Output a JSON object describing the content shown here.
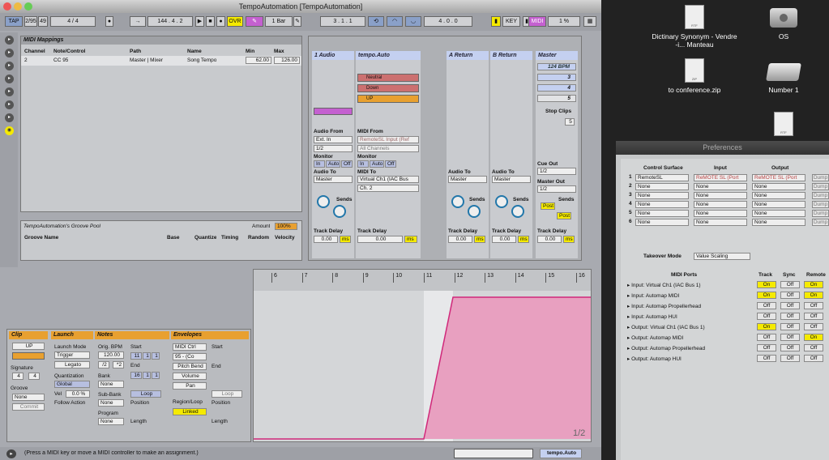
{
  "window_title": "TempoAutomation  [TempoAutomation]",
  "transport": {
    "tap": "TAP",
    "sig": "2/95",
    "sig2": "49",
    "meter": "4  /  4",
    "tempo": "144 . 4 . 2",
    "quant": "1 Bar",
    "pos": "3 . 1 . 1",
    "pos2": "4 . 0 . 0",
    "key": "KEY",
    "midi": "MIDI",
    "cpu": "1 %",
    "ovr": "OVR"
  },
  "desktop": {
    "icons": [
      {
        "label": "Dictinary Synonym - Vendre -i... Manteau",
        "kind": "RTF"
      },
      {
        "label": "OS",
        "kind": "disk"
      },
      {
        "label": "to conference.zip",
        "kind": "ZIP"
      },
      {
        "label": "Number 1",
        "kind": "hdd"
      },
      {
        "label": "",
        "kind": "RTF"
      }
    ]
  },
  "prefs": {
    "title": "Preferences",
    "cols": [
      "Control Surface",
      "Input",
      "Output"
    ],
    "rows": [
      {
        "n": "1",
        "cs": "RemoteSL",
        "in": "ReMOTE SL (Port",
        "out": "ReMOTE SL (Port",
        "dump": "Dump"
      },
      {
        "n": "2",
        "cs": "None",
        "in": "None",
        "out": "None",
        "dump": "Dump"
      },
      {
        "n": "3",
        "cs": "None",
        "in": "None",
        "out": "None",
        "dump": "Dump"
      },
      {
        "n": "4",
        "cs": "None",
        "in": "None",
        "out": "None",
        "dump": "Dump"
      },
      {
        "n": "5",
        "cs": "None",
        "in": "None",
        "out": "None",
        "dump": "Dump"
      },
      {
        "n": "6",
        "cs": "None",
        "in": "None",
        "out": "None",
        "dump": "Dump"
      }
    ],
    "takeover_label": "Takeover Mode",
    "takeover": "Value Scaling",
    "ports_headers": [
      "MIDI Ports",
      "Track",
      "Sync",
      "Remote"
    ],
    "ports": [
      {
        "name": "Input:  Virtual Ch1 (IAC Bus 1)",
        "t": "On",
        "s": "Off",
        "r": "On"
      },
      {
        "name": "Input:  Automap MIDI",
        "t": "On",
        "s": "Off",
        "r": "On"
      },
      {
        "name": "Input:  Automap Propellerhead",
        "t": "Off",
        "s": "Off",
        "r": "Off"
      },
      {
        "name": "Input:  Automap HUI",
        "t": "Off",
        "s": "Off",
        "r": "Off"
      },
      {
        "name": "Output:  Virtual Ch1 (IAC Bus 1)",
        "t": "On",
        "s": "Off",
        "r": "Off"
      },
      {
        "name": "Output:  Automap MIDI",
        "t": "Off",
        "s": "Off",
        "r": "On"
      },
      {
        "name": "Output:  Automap Propellerhead",
        "t": "Off",
        "s": "Off",
        "r": "Off"
      },
      {
        "name": "Output:  Automap HUI",
        "t": "Off",
        "s": "Off",
        "r": "Off"
      }
    ]
  },
  "mappings": {
    "title": "MIDI Mappings",
    "headers": [
      "Channel",
      "Note/Control",
      "Path",
      "Name",
      "Min",
      "Max"
    ],
    "row": [
      "2",
      "CC 95",
      "Master | Mixer",
      "Song Tempo",
      "62.00",
      "126.00"
    ]
  },
  "groove": {
    "title": "TempoAutomation's Groove Pool",
    "amount_label": "Amount",
    "amount": "100%",
    "headers": [
      "Groove Name",
      "Base",
      "Quantize",
      "Timing",
      "Random",
      "Velocity"
    ]
  },
  "tracks": {
    "t1": "1 Audio",
    "t2": "tempo.Auto",
    "a": "A Return",
    "b": "B Return",
    "master": "Master",
    "clips": [
      "Neutral",
      "Down",
      "UP"
    ],
    "bpm": "124 BPM",
    "scenes": [
      "3",
      "4",
      "5"
    ],
    "stop": "Stop Clips",
    "scene_num": "5",
    "audio_from": "Audio From",
    "ext_in": "Ext. In",
    "ch12": "1/2",
    "midi_from": "MIDI From",
    "remote_in": "RemoteSL Input (Ref",
    "all_ch": "All Channels",
    "monitor": "Monitor",
    "in": "In",
    "auto": "Auto",
    "off": "Off",
    "audio_to": "Audio To",
    "master_out": "Master",
    "midi_to": "MIDI To",
    "iac": "Virtual Ch1 (IAC Bus",
    "ch2": "Ch. 2",
    "cue_out": "Cue Out",
    "cue_val": "1/2",
    "master_out_lbl": "Master Out",
    "mo_val": "1/2",
    "sends": "Sends",
    "post": "Post",
    "track_delay": "Track Delay",
    "delay_val": "0.00",
    "ms": "ms"
  },
  "clipview": {
    "clip": "Clip",
    "clipname": "UP",
    "signature": "Signature",
    "sig_n": "4",
    "sig_d": "4",
    "groove": "Groove",
    "groove_val": "None",
    "commit": "Commit",
    "launch": "Launch",
    "launch_mode": "Launch Mode",
    "trigger": "Trigger",
    "legato": "Legato",
    "quantization": "Quantization",
    "global": "Global",
    "vel": "Vel",
    "vel_val": "0.0 %",
    "follow": "Follow Action",
    "notes": "Notes",
    "orig_bpm": "Orig. BPM",
    "bpm_val": "120.00",
    "half": "/2",
    "dbl": "*2",
    "bank": "Bank",
    "sub_bank": "Sub-Bank",
    "program": "Program",
    "none": "None",
    "start": "Start",
    "end": "End",
    "loop": "Loop",
    "position": "Position",
    "length": "Length",
    "envelopes": "Envelopes",
    "env1": "MIDI Ctrl",
    "env2": "95 - (Co",
    "pitch": "Pitch Bend",
    "volume": "Volume",
    "pan": "Pan",
    "region": "Region/Loop",
    "linked": "Linked",
    "start_v": [
      "11",
      "1",
      "1"
    ],
    "end_v": [
      "16",
      "1",
      "1"
    ],
    "ruler": [
      "6",
      "7",
      "8",
      "9",
      "10",
      "11",
      "12",
      "13",
      "14",
      "15",
      "16"
    ],
    "page": "1/2"
  },
  "status": {
    "hint": "(Press a MIDI key or move a MIDI controller to make an assignment.)",
    "track": "tempo.Auto"
  },
  "colors": {
    "pink": "#e8a0c0",
    "yellow": "#f5ea00",
    "purple": "#c460d0",
    "orange": "#e8a030"
  }
}
